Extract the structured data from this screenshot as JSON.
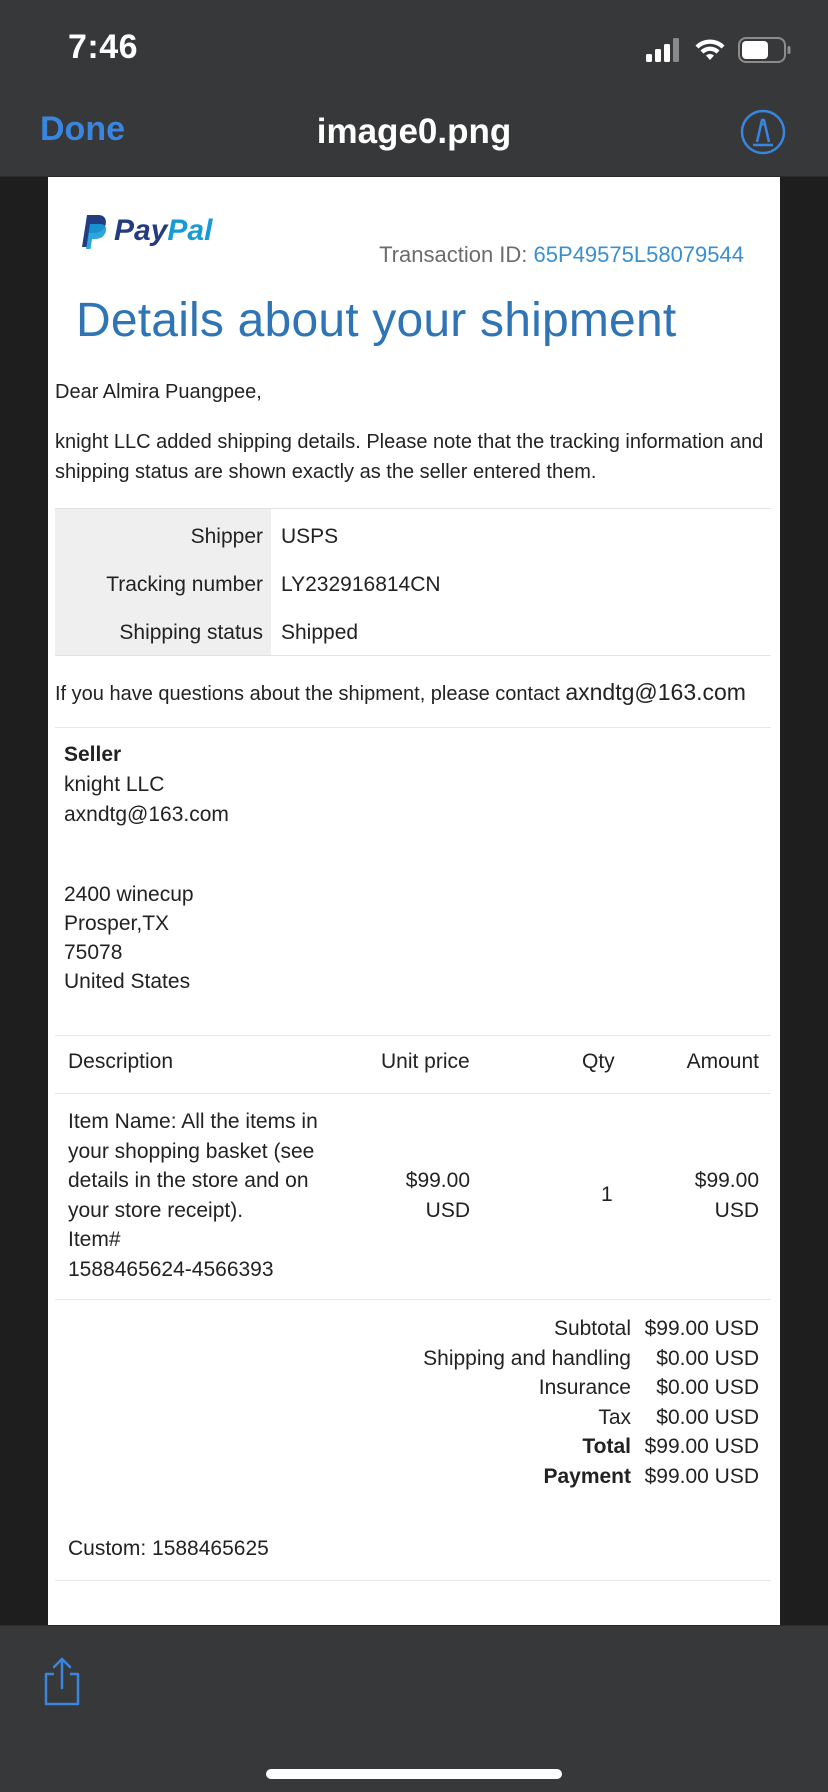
{
  "status_bar": {
    "time": "7:46"
  },
  "nav": {
    "done_label": "Done",
    "title": "image0.png"
  },
  "document": {
    "brand": {
      "pay": "Pay",
      "pal": "Pal"
    },
    "transaction_label": "Transaction ID:",
    "transaction_id": "65P49575L58079544",
    "heading": "Details about your shipment",
    "greeting": "Dear Almira Puangpee,",
    "intro": "knight LLC added shipping details. Please note that the tracking information and shipping status are shown exactly as the seller entered them.",
    "shipping": [
      {
        "label": "Shipper",
        "value": "USPS"
      },
      {
        "label": "Tracking number",
        "value": "LY232916814CN"
      },
      {
        "label": "Shipping status",
        "value": "Shipped"
      }
    ],
    "contact_text": "If you have questions about the shipment, please contact",
    "contact_email": "axndtg@163.com",
    "seller": {
      "title": "Seller",
      "name": "knight LLC",
      "email": "axndtg@163.com",
      "address": [
        "2400 winecup",
        "Prosper,TX",
        "75078",
        "United States"
      ]
    },
    "items_table": {
      "headers": [
        "Description",
        "Unit price",
        "Qty",
        "Amount"
      ],
      "row": {
        "description": "Item Name: All the items in your shopping basket (see details in the store and on your store receipt).",
        "item_number_label": "Item#",
        "item_number": "1588465624-4566393",
        "unit_price": "$99.00",
        "unit_price_currency": "USD",
        "qty": "1",
        "amount": "$99.00",
        "amount_currency": "USD"
      }
    },
    "totals": [
      {
        "label": "Subtotal",
        "value": "$99.00 USD",
        "bold": false
      },
      {
        "label": "Shipping and handling",
        "value": "$0.00 USD",
        "bold": false
      },
      {
        "label": "Insurance",
        "value": "$0.00 USD",
        "bold": false
      },
      {
        "label": "Tax",
        "value": "$0.00 USD",
        "bold": false
      },
      {
        "label": "Total",
        "value": "$99.00 USD",
        "bold": true
      },
      {
        "label": "Payment",
        "value": "$99.00 USD",
        "bold": true
      }
    ],
    "custom": "Custom: 1588465625"
  },
  "colors": {
    "accent": "#3a85e0",
    "heading_blue": "#2f74b5",
    "bar_bg": "#373839",
    "paypal_dark": "#253b80",
    "paypal_light": "#179bd7"
  }
}
